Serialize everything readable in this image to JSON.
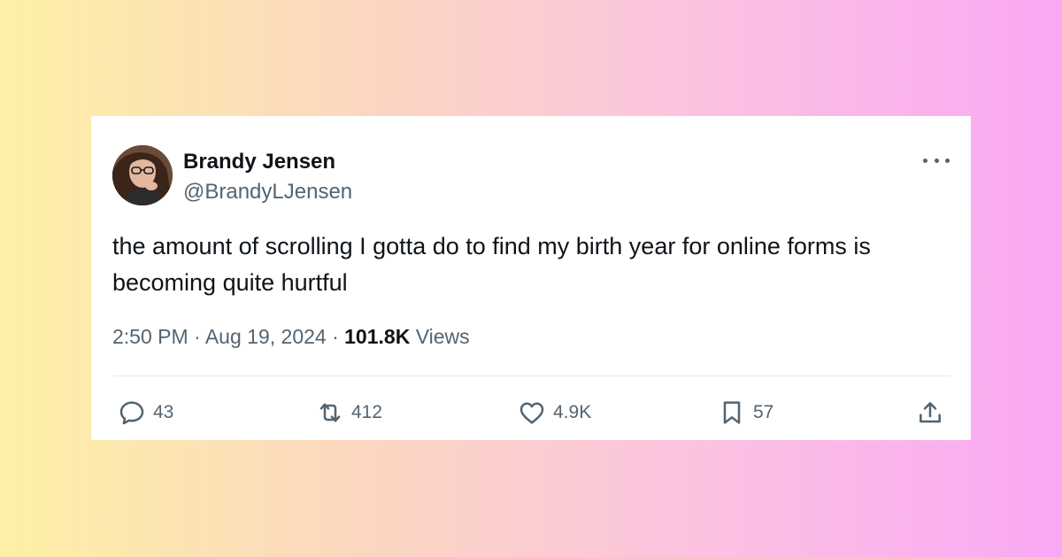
{
  "tweet": {
    "author": {
      "name": "Brandy Jensen",
      "handle": "@BrandyLJensen"
    },
    "text": "the amount of scrolling I gotta do to find my birth year for online forms is becoming quite hurtful",
    "time": "2:50 PM",
    "date": "Aug 19, 2024",
    "separator": "·",
    "views_count": "101.8K",
    "views_label": "Views",
    "stats": {
      "replies": "43",
      "retweets": "412",
      "likes": "4.9K",
      "bookmarks": "57"
    }
  },
  "icons": {
    "more": "more-horizontal-icon",
    "reply": "reply-icon",
    "retweet": "retweet-icon",
    "like": "heart-icon",
    "bookmark": "bookmark-icon",
    "share": "share-icon"
  },
  "colors": {
    "text_primary": "#0f1419",
    "text_secondary": "#536471",
    "background_gradient_start": "#fdf0a6",
    "background_gradient_end": "#f9a8f4",
    "card_background": "#ffffff"
  }
}
